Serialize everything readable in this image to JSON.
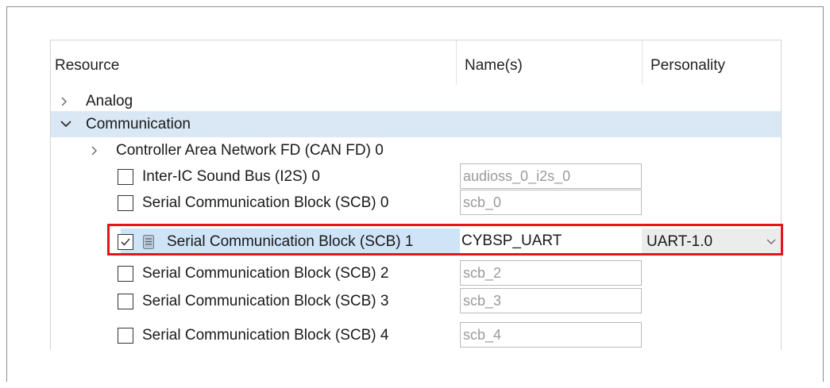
{
  "columns": {
    "resource": "Resource",
    "names": "Name(s)",
    "personality": "Personality"
  },
  "rows": [
    {
      "label": "Analog"
    },
    {
      "label": "Communication"
    },
    {
      "label": "Controller Area Network FD (CAN FD) 0"
    },
    {
      "label": "Inter-IC Sound Bus (I2S) 0",
      "name": "audioss_0_i2s_0",
      "checked": false
    },
    {
      "label": "Serial Communication Block (SCB) 0",
      "name": "scb_0",
      "checked": false
    },
    {
      "label": "Serial Communication Block (SCB) 1",
      "name": "CYBSP_UART",
      "checked": true,
      "personality": "UART-1.0"
    },
    {
      "label": "Serial Communication Block (SCB) 2",
      "name": "scb_2",
      "checked": false
    },
    {
      "label": "Serial Communication Block (SCB) 3",
      "name": "scb_3",
      "checked": false
    },
    {
      "label": "Serial Communication Block (SCB) 4",
      "name": "scb_4",
      "checked": false
    }
  ],
  "icons": {
    "collapsed": "chevron-right-icon",
    "expanded": "chevron-down-icon",
    "checked": "checkmark-icon",
    "config": "document-icon",
    "dropdown": "chevron-down-icon"
  },
  "colors": {
    "selection_band": "#dae8f5",
    "highlight": "#e8141b",
    "personality_bg": "#ececec"
  }
}
